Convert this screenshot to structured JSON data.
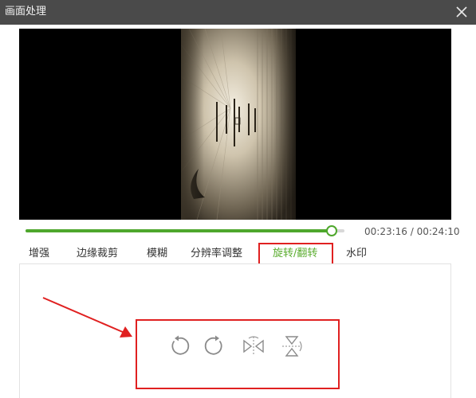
{
  "window": {
    "title": "画面处理",
    "close_icon": "close-icon"
  },
  "player": {
    "progress_fraction": 0.96,
    "current_time": "00:23:16",
    "separator": "/",
    "total_time": "00:24:10",
    "accent_color": "#4ea72c"
  },
  "tabs": [
    {
      "label": "增强",
      "active": false
    },
    {
      "label": "边缘裁剪",
      "active": false
    },
    {
      "label": "模糊",
      "active": false
    },
    {
      "label": "分辨率调整",
      "active": false
    },
    {
      "label": "旋转/翻转",
      "active": true
    },
    {
      "label": "水印",
      "active": false
    }
  ],
  "rotate_tools": [
    {
      "icon": "rotate-left-icon"
    },
    {
      "icon": "rotate-right-icon"
    },
    {
      "icon": "flip-horizontal-icon"
    },
    {
      "icon": "flip-vertical-icon"
    }
  ],
  "colors": {
    "active_tab": "#5aac2e",
    "annotation": "#e02020",
    "titlebar": "#4a4a4a"
  }
}
